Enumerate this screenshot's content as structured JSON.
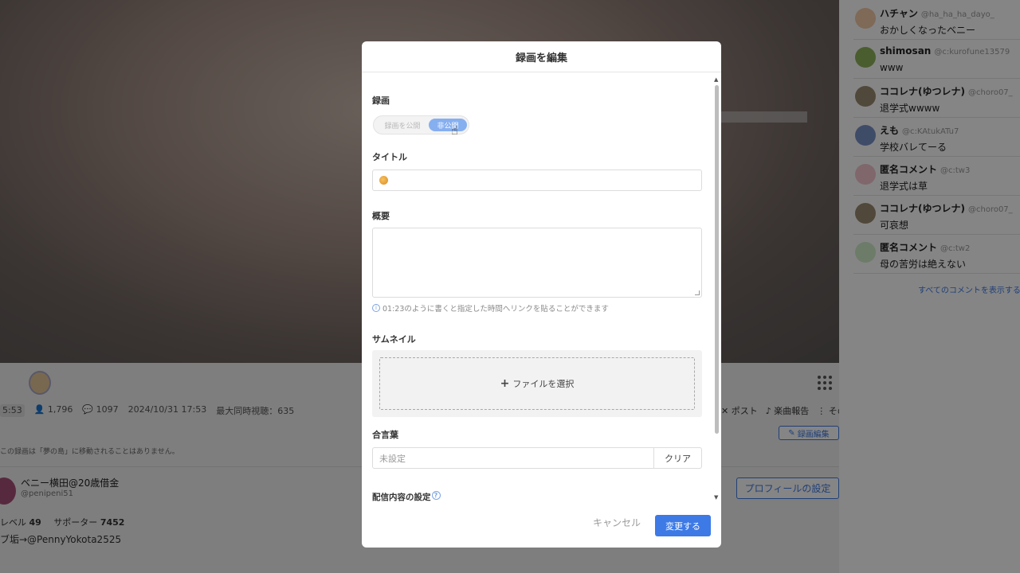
{
  "background": {
    "stats": {
      "time": "5:53",
      "viewers": "1,796",
      "comments": "1097",
      "datetime": "2024/10/31 17:53",
      "max_concurrent": "最大同時視聴：635"
    },
    "notice": "この録画は「夢の島」に移動されることはありません。",
    "actions": {
      "post": "ポスト",
      "music_report": "楽曲報告",
      "more": "その他"
    },
    "edit_recording_button": "録画編集",
    "user": {
      "name": "ベニー横田@20歳借金",
      "handle": "@penipeni51",
      "level_label": "レベル",
      "level": "49",
      "supporters_label": "サポーター",
      "supporters": "7452",
      "link_text": "ブ垢→@PennyYokota2525"
    },
    "profile_settings_button": "プロフィールの設定"
  },
  "comments": [
    {
      "name": "ハチャン",
      "handle": "@ha_ha_ha_dayo_",
      "text": "おかしくなったベニー",
      "avatar_color": "#f3c9a8"
    },
    {
      "name": "shimosan",
      "handle": "@c:kurofune13579",
      "text": "www",
      "avatar_color": "#8fb35a"
    },
    {
      "name": "ココレナ(ゆつレナ)",
      "handle": "@choro07_",
      "text": "退学式wwww",
      "avatar_color": "#9a8a70"
    },
    {
      "name": "えも",
      "handle": "@c:KAtukATu7",
      "text": "学校バレてーる",
      "avatar_color": "#7a93c7"
    },
    {
      "name": "匿名コメント",
      "handle": "@c:tw3",
      "text": "退学式は草",
      "avatar_color": "#f4c6cf"
    },
    {
      "name": "ココレナ(ゆつレナ)",
      "handle": "@choro07_",
      "text": "可哀想",
      "avatar_color": "#9a8a70"
    },
    {
      "name": "匿名コメント",
      "handle": "@c:tw2",
      "text": "母の苦労は絶えない",
      "avatar_color": "#cfeec9"
    }
  ],
  "all_comments_link": "すべてのコメントを表示する",
  "modal": {
    "title": "録画を編集",
    "recording_label": "録画",
    "toggle": {
      "public": "録画を公開",
      "private": "非公開",
      "selected": "非公開"
    },
    "title_label": "タイトル",
    "summary_label": "概要",
    "summary_hint": "01:23のように書くと指定した時間へリンクを貼ることができます",
    "thumbnail_label": "サムネイル",
    "file_select": "ファイルを選択",
    "passphrase_label": "合言葉",
    "passphrase_placeholder": "未設定",
    "clear_button": "クリア",
    "stream_settings_label": "配信内容の設定",
    "cancel_button": "キャンセル",
    "submit_button": "変更する"
  }
}
